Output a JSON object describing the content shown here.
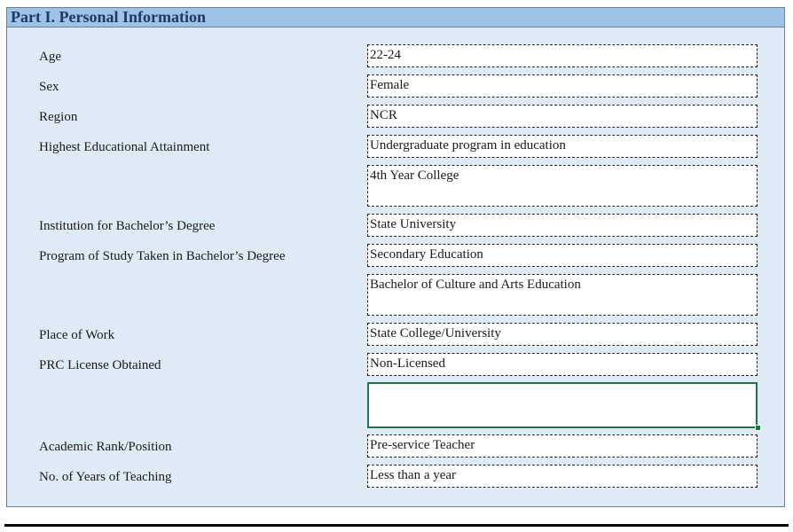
{
  "header": {
    "title": "Part I. Personal Information"
  },
  "fields": {
    "age": {
      "label": "Age",
      "value": "22-24"
    },
    "sex": {
      "label": "Sex",
      "value": "Female"
    },
    "region": {
      "label": "Region",
      "value": "NCR"
    },
    "education": {
      "label": "Highest Educational Attainment",
      "value": "Undergraduate program in education",
      "extra": "4th Year College"
    },
    "institution": {
      "label": "Institution for Bachelor’s Degree",
      "value": "State University"
    },
    "program": {
      "label": "Program of Study Taken in Bachelor’s Degree",
      "value": "Secondary Education",
      "extra": "Bachelor of Culture and Arts Education"
    },
    "workplace": {
      "label": "Place of Work",
      "value": "State College/University"
    },
    "license": {
      "label": "PRC License Obtained",
      "value": "Non-Licensed",
      "extra": ""
    },
    "rank": {
      "label": "Academic Rank/Position",
      "value": "Pre-service Teacher"
    },
    "years": {
      "label": "No. of Years of Teaching",
      "value": "Less than a year"
    }
  }
}
